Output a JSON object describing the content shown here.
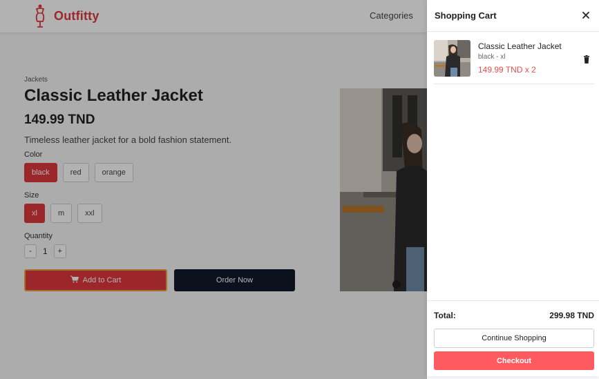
{
  "brand": {
    "name": "Outfitty",
    "color": "#e0393e"
  },
  "nav": {
    "categories": "Categories"
  },
  "product": {
    "breadcrumb": "Jackets",
    "title": "Classic Leather Jacket",
    "price": "149.99 TND",
    "description": "Timeless leather jacket for a bold fashion statement.",
    "color_label": "Color",
    "colors": [
      "black",
      "red",
      "orange"
    ],
    "selected_color": "black",
    "size_label": "Size",
    "sizes": [
      "xl",
      "m",
      "xxl"
    ],
    "selected_size": "xl",
    "quantity_label": "Quantity",
    "quantity": "1",
    "minus": "-",
    "plus": "+",
    "add_to_cart": "Add to Cart",
    "order_now": "Order Now",
    "image_icon": "product-photo"
  },
  "cart": {
    "title": "Shopping Cart",
    "close_icon": "close-icon",
    "items": [
      {
        "name": "Classic Leather Jacket",
        "variant": "black - xl",
        "price_qty": "149.99 TND x 2",
        "delete_icon": "trash-icon"
      }
    ],
    "total_label": "Total:",
    "total_value": "299.98 TND",
    "continue_label": "Continue Shopping",
    "checkout_label": "Checkout"
  },
  "colors": {
    "accent": "#e0393e",
    "checkout": "#ff5a5f",
    "order_button": "#111a2b",
    "price_red": "#e94e4f"
  }
}
